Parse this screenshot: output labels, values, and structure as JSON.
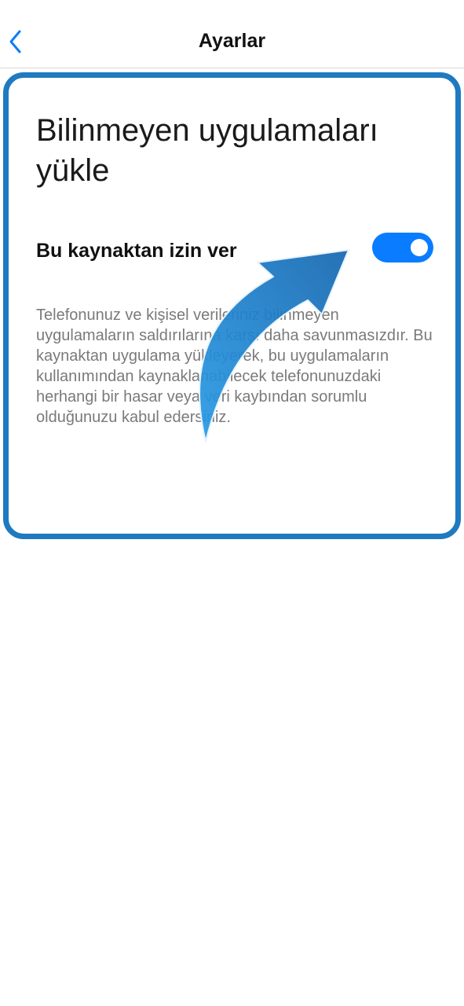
{
  "header": {
    "title": "Ayarlar",
    "back_icon": "chevron-left-icon"
  },
  "card": {
    "title": "Bilinmeyen uygulamaları yükle",
    "setting_label": "Bu kaynaktan izin ver",
    "toggle_on": true,
    "description": "Telefonunuz ve kişisel verileriniz bilinmeyen uygulamaların saldırılarına karşı daha savunmasızdır. Bu kaynaktan uygulama yükleyerek, bu uygulamaların kullanımından kaynaklanabilecek telefonunuzdaki herhangi bir hasar veya veri kaybından sorumlu olduğunuzu kabul edersiniz."
  },
  "colors": {
    "accent": "#0a7cff",
    "highlight_border": "#1f7ac0",
    "arrow": "#1a86d0"
  },
  "annotation": {
    "icon": "pointer-arrow-icon"
  }
}
